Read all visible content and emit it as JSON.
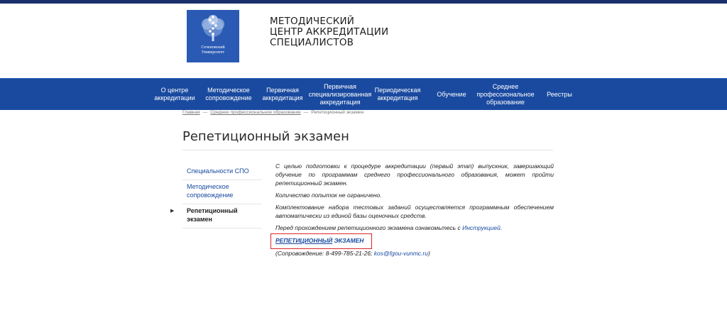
{
  "header": {
    "logo_line1": "Сеченовский",
    "logo_line2": "Университет",
    "title_line1": "МЕТОДИЧЕСКИЙ",
    "title_line2": "ЦЕНТР АККРЕДИТАЦИИ",
    "title_line3": "СПЕЦИАЛИСТОВ"
  },
  "nav": {
    "items": [
      {
        "l1": "О центре",
        "l2": "аккредитации",
        "l3": ""
      },
      {
        "l1": "Методическое",
        "l2": "сопровождение",
        "l3": ""
      },
      {
        "l1": "Первичная",
        "l2": "аккредитация",
        "l3": ""
      },
      {
        "l1": "Первичная",
        "l2": "специализированная",
        "l3": "аккредитация"
      },
      {
        "l1": "Периодическая",
        "l2": "аккредитация",
        "l3": ""
      },
      {
        "l1": "Обучение",
        "l2": "",
        "l3": ""
      },
      {
        "l1": "Среднее",
        "l2": "профессиональное",
        "l3": "образование"
      },
      {
        "l1": "Реестры",
        "l2": "",
        "l3": ""
      }
    ]
  },
  "breadcrumb": {
    "home": "Главная",
    "section": "Среднее профессиональное образование",
    "current": "Репетиционный экзамен",
    "separator": "—"
  },
  "page": {
    "title": "Репетиционный экзамен"
  },
  "side_menu": {
    "items": [
      {
        "line1": "Специальности СПО",
        "line2": ""
      },
      {
        "line1": "Методическое",
        "line2": "сопровождение"
      },
      {
        "line1": "Репетиционный экзамен",
        "line2": ""
      }
    ]
  },
  "content": {
    "para1": "С целью подготовки к процедуре аккредитации (первый этап) выпускник, завершающий обучение по программам среднего профессионального образования, может пройти репетиционный экзамен.",
    "para2": "Количество попыток не ограничено.",
    "para3": "Комплектование набора тестовых заданий осуществляется программным обеспечением автоматически из единой базы оценочных средств.",
    "para4_prefix": "Перед прохождением репетиционного экзамена ознакомьтесь с ",
    "para4_link": "Инструкцией",
    "para4_suffix": ".",
    "exam_link_part1": "РЕПЕТИЦИОННЫЙ",
    "exam_link_part2": " ЭКЗАМЕН",
    "support_prefix": "(Сопровождение: 8-499-785-21-26; ",
    "support_email": "kos@fgou-vunmc.ru",
    "support_suffix": ")"
  },
  "colors": {
    "brand_blue": "#1a4aa0",
    "logo_blue": "#2a5ab4",
    "highlight_red": "#d9262b"
  }
}
